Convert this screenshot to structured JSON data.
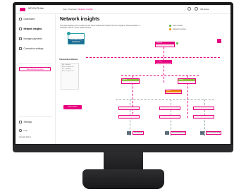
{
  "app": {
    "brand": "MPLS/VPN link",
    "breadcrumb_prefix": "Eco / Overview /",
    "breadcrumb_current": "Network insights",
    "user": "Ola Naise"
  },
  "sidebar": {
    "items": [
      {
        "label": "Dashboard"
      },
      {
        "label": "Network insights"
      },
      {
        "label": "Manage payments"
      },
      {
        "label": "Connection settings"
      }
    ],
    "button": "Start Monitoring Now",
    "bottom": [
      {
        "label": "Settings"
      },
      {
        "label": "Help"
      },
      {
        "label": "Contact Admin"
      }
    ]
  },
  "main": {
    "title": "Network insights",
    "description": "This page displays you the status of your cloud network and relevant from the suppliers. Write description a feedback a link for. These details licenses.",
    "legend": [
      "New network",
      "Network overview"
    ],
    "dashboard_card": "CCD Monitoring Dashboard",
    "sub_title": "Transaction Monitor",
    "panel_lines": [
      "Not - Analytic",
      "Active support list",
      "Sec - Analytic",
      "Active support list"
    ],
    "start_button": "Start search",
    "nodes": {
      "top": "Gateway",
      "mid": "Tracking",
      "l1": "Router",
      "l2": "Router",
      "l3": "Router"
    },
    "bottom_labels": [
      "Security bus",
      "Fax Manufacturing",
      "Fax Manufacturing"
    ]
  },
  "colors": {
    "accent": "#e6007e",
    "green": "#52b043",
    "orange": "#f08c00",
    "teal": "#2aa0a4"
  }
}
